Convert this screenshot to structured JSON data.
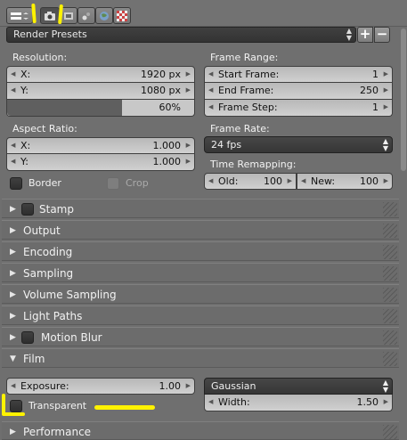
{
  "presets": {
    "label": "Render Presets",
    "add": "+",
    "remove": "−"
  },
  "resolution": {
    "label": "Resolution:",
    "x_label": "X:",
    "x_value": "1920 px",
    "y_label": "Y:",
    "y_value": "1080 px",
    "percent": "60%",
    "percent_fill": 0.6
  },
  "frame_range": {
    "label": "Frame Range:",
    "start_label": "Start Frame:",
    "start_value": "1",
    "end_label": "End Frame:",
    "end_value": "250",
    "step_label": "Frame Step:",
    "step_value": "1"
  },
  "aspect": {
    "label": "Aspect Ratio:",
    "x_label": "X:",
    "x_value": "1.000",
    "y_label": "Y:",
    "y_value": "1.000"
  },
  "frame_rate": {
    "label": "Frame Rate:",
    "value": "24 fps"
  },
  "time_remap": {
    "label": "Time Remapping:",
    "old_label": "Old:",
    "old_value": "100",
    "new_label": "New:",
    "new_value": "100"
  },
  "border_label": "Border",
  "crop_label": "Crop",
  "panels": {
    "stamp": "Stamp",
    "output": "Output",
    "encoding": "Encoding",
    "sampling": "Sampling",
    "volume_sampling": "Volume Sampling",
    "light_paths": "Light Paths",
    "motion_blur": "Motion Blur",
    "film": "Film",
    "performance": "Performance"
  },
  "film": {
    "exposure_label": "Exposure:",
    "exposure_value": "1.00",
    "filter_type": "Gaussian",
    "width_label": "Width:",
    "width_value": "1.50",
    "transparent_label": "Transparent"
  },
  "colors": {
    "highlight": "#fff200",
    "panel_bg": "#6f6f6f",
    "field_bg": "#c4c4c4"
  }
}
